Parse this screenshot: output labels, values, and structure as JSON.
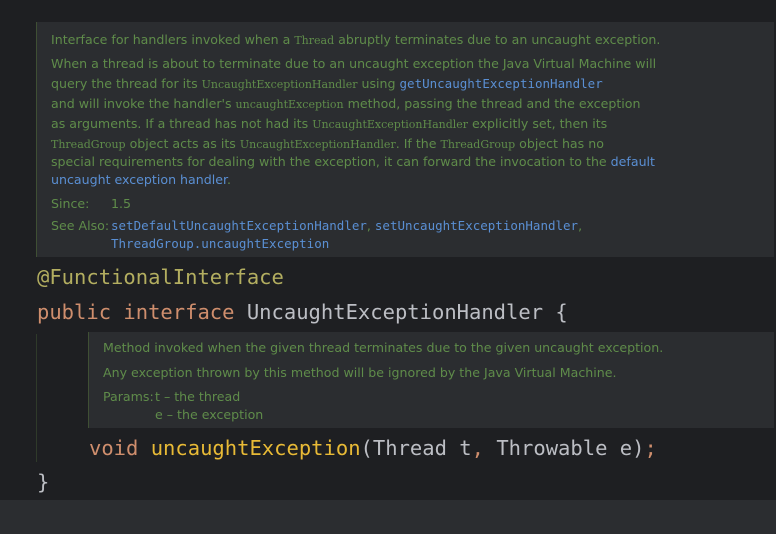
{
  "doc_comment_1": {
    "line1": {
      "a": "Interface for handlers invoked when a ",
      "code": "Thread",
      "b": " abruptly terminates due to an uncaught exception."
    },
    "p2_l1": "When a thread is about to terminate due to an uncaught exception the Java Virtual Machine will",
    "p2_l2": {
      "a": "query the thread for its ",
      "code": "UncaughtExceptionHandler",
      "b": " using ",
      "link": "getUncaughtExceptionHandler"
    },
    "p2_l3": {
      "a": "and will invoke the handler's ",
      "code": "uncaughtException",
      "b": " method, passing the thread and the exception"
    },
    "p2_l4": {
      "a": "as arguments. If a thread has not had its ",
      "code": "UncaughtExceptionHandler",
      "b": " explicitly set, then its"
    },
    "p2_l5": {
      "code1": "ThreadGroup",
      "a": " object acts as its ",
      "code2": "UncaughtExceptionHandler",
      "b": ". If the ",
      "code3": "ThreadGroup",
      "c": " object has no"
    },
    "p2_l6": {
      "a": "special requirements for dealing with the exception, it can forward the invocation to the ",
      "link": "default"
    },
    "p2_l7": {
      "link": "uncaught exception handler",
      "b": "."
    },
    "since_label": "Since:",
    "since_value": "1.5",
    "see_also_label": "See Also:",
    "see_also_1": "setDefaultUncaughtExceptionHandler",
    "sep1": ", ",
    "see_also_2": "setUncaughtExceptionHandler",
    "sep2": ",",
    "see_also_3": "ThreadGroup.uncaughtException"
  },
  "code": {
    "annotation": "@FunctionalInterface",
    "kw_public": "public",
    "kw_interface": "interface",
    "type_name": "UncaughtExceptionHandler",
    "open_brace": "{",
    "kw_void": "void",
    "method_name": "uncaughtException",
    "paren_open": "(",
    "param1": "Thread t",
    "comma": ",",
    "param2": "Throwable e",
    "paren_close": ")",
    "semicolon": ";",
    "close_brace": "}"
  },
  "doc_comment_2": {
    "line1": "Method invoked when the given thread terminates due to the given uncaught exception.",
    "line2": "Any exception thrown by this method will be ignored by the Java Virtual Machine.",
    "params_label": "Params:",
    "param_t": "t – the thread",
    "param_e": "e – the exception"
  },
  "colors": {
    "background": "#1e1f22",
    "doc_bg": "#2b2d30",
    "doc_text": "#5f8c4a",
    "link": "#5a8fd3",
    "keyword": "#cf8e6d",
    "annotation": "#b3ae60",
    "method": "#e8ba36"
  }
}
